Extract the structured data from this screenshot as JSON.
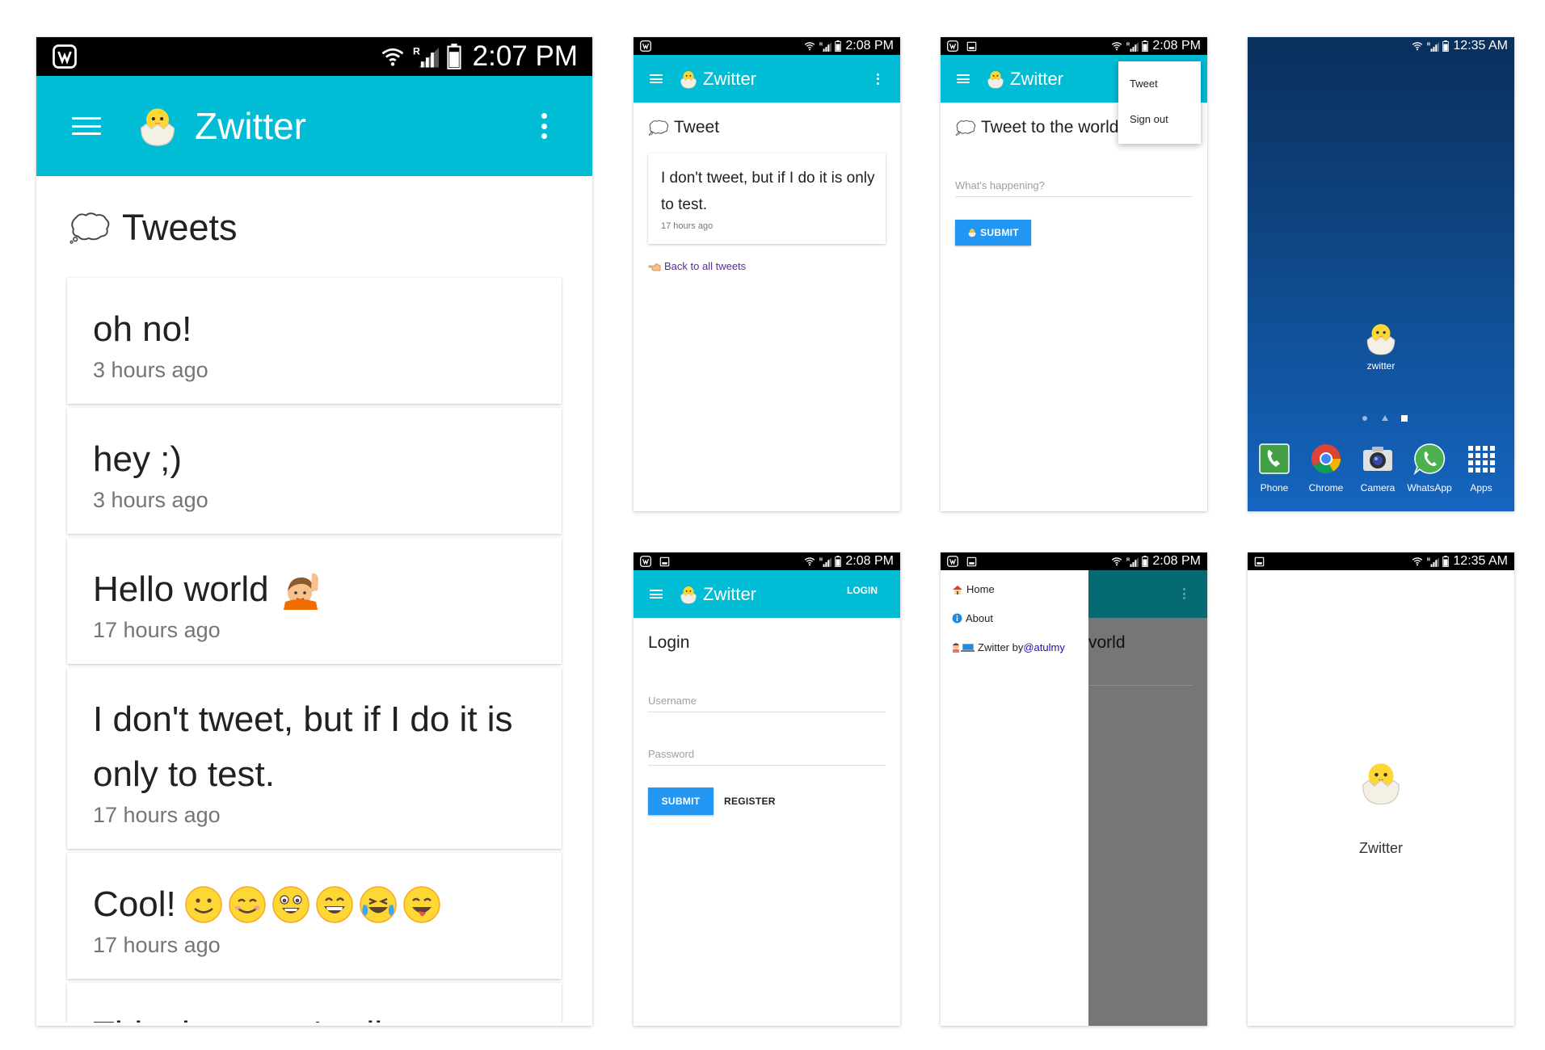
{
  "app": {
    "name": "Zwitter"
  },
  "status": {
    "time_main": "2:07 PM",
    "time_208": "2:08 PM",
    "time_1235": "12:35 AM"
  },
  "colors": {
    "primary": "#00bcd4",
    "button_blue": "#2196f3",
    "link_purple": "#5b2b96",
    "link_blue": "#1a0dab"
  },
  "panel1": {
    "heading": "Tweets",
    "tweets": [
      {
        "text": "oh no!",
        "ago": "3 hours ago"
      },
      {
        "text": "hey ;)",
        "ago": "3 hours ago"
      },
      {
        "text": "Hello world",
        "ago": "17 hours ago",
        "emoji": "raising-hand-emoji"
      },
      {
        "text": "I don't tweet, but if I do it is only to test.",
        "ago": "17 hours ago"
      },
      {
        "text": "Cool!",
        "ago": "17 hours ago",
        "emoji": "smiley-emoji-row"
      },
      {
        "text": "This data won't wil"
      }
    ]
  },
  "panel2": {
    "heading": "Tweet",
    "tweet_text": "I don't tweet, but if I do it is only to test.",
    "tweet_ago": "17 hours ago",
    "back_link": "Back to all tweets"
  },
  "panel3": {
    "heading": "Tweet to the world",
    "placeholder": "What's happening?",
    "submit": "SUBMIT",
    "menu": [
      "Tweet",
      "Sign out"
    ]
  },
  "panel4": {
    "app_label": "zwitter",
    "dock": [
      "Phone",
      "Chrome",
      "Camera",
      "WhatsApp",
      "Apps"
    ]
  },
  "panel5": {
    "login_action": "LOGIN",
    "heading": "Login",
    "username_placeholder": "Username",
    "password_placeholder": "Password",
    "submit": "SUBMIT",
    "register": "REGISTER"
  },
  "panel6": {
    "drawer_home": "Home",
    "drawer_about": "About",
    "drawer_credit": "Zwitter by ",
    "drawer_credit_handle": "@atulmy",
    "behind_text": "vorld"
  },
  "panel7": {
    "app_name": "Zwitter"
  }
}
